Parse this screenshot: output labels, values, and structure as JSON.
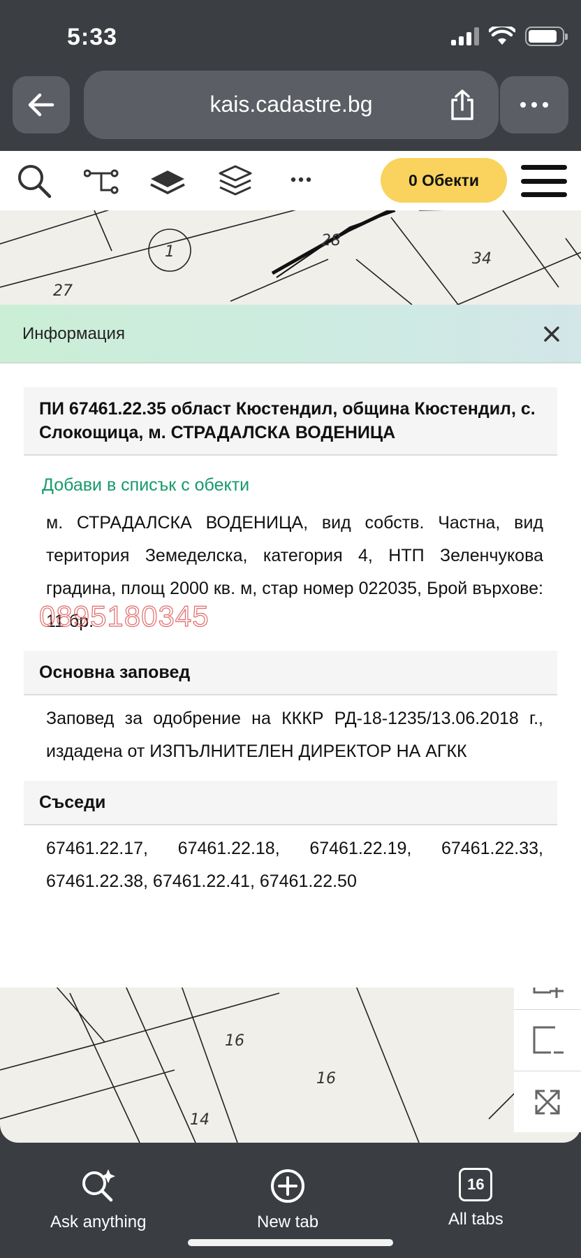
{
  "status_bar": {
    "time": "5:33"
  },
  "browser": {
    "url": "kais.cadastre.bg",
    "icons": [
      "back-arrow-icon",
      "share-icon",
      "more-icon"
    ]
  },
  "site_toolbar": {
    "icons": [
      "search-icon",
      "route-icon",
      "layer-icon",
      "layers-icon",
      "ellipsis-icon",
      "hamburger-icon"
    ],
    "objects_button": "0 Обекти",
    "accent_color": "#f9d35e"
  },
  "map": {
    "labels": [
      "1",
      "28",
      "34",
      "27",
      "16",
      "16",
      "14"
    ]
  },
  "info_panel": {
    "title": "Информация",
    "parcel_heading": "ПИ 67461.22.35 област Кюстендил, община Кюстендил, с. Слокощица, м. СТРАДАЛСКА ВОДЕНИЦА",
    "add_link": "Добави в списък с обекти",
    "parcel_details": "м. СТРАДАЛСКА ВОДЕНИЦА, вид собств. Частна, вид територия Земеделска, категория 4, НТП Зеленчукова градина, площ 2000 кв. м, стар номер 022035, Брой върхове: 11 бр.",
    "order_heading": "Основна заповед",
    "order_text": "Заповед за одобрение на КККР РД-18-1235/13.06.2018 г., издадена от ИЗПЪЛНИТЕЛЕН ДИРЕКТОР НА АГКК",
    "neighbors_heading": "Съседи",
    "neighbors_text": "67461.22.17, 67461.22.18, 67461.22.19, 67461.22.33, 67461.22.38, 67461.22.41, 67461.22.50",
    "link_color": "#179a6a"
  },
  "watermark": "0895180345",
  "bottom_bar": {
    "ask": "Ask anything",
    "new_tab": "New tab",
    "all_tabs": "All tabs",
    "tab_count": "16"
  }
}
